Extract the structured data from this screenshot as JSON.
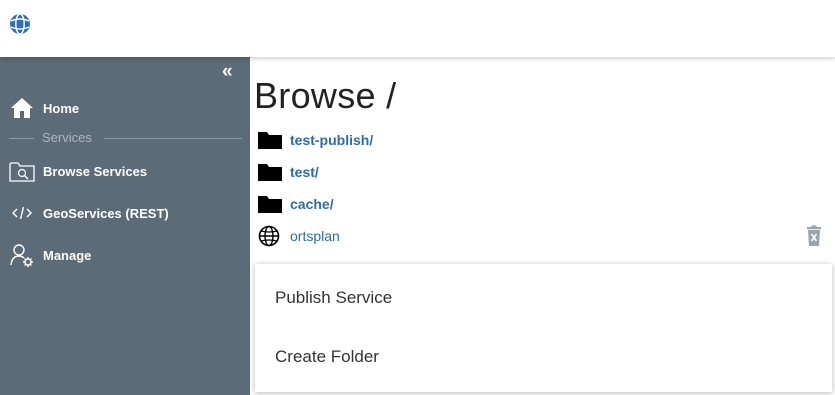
{
  "header": {
    "logo_icon": "globe-logo-icon"
  },
  "sidebar": {
    "collapse_glyph": "«",
    "items": [
      {
        "label": "Home",
        "icon": "home-icon"
      },
      {
        "label": "Browse Services",
        "icon": "browse-services-icon"
      },
      {
        "label": "GeoServices (REST)",
        "icon": "code-icon"
      },
      {
        "label": "Manage",
        "icon": "manage-user-gear-icon"
      }
    ],
    "section_label": "Services",
    "background": "#5b6b78"
  },
  "main": {
    "title": "Browse /",
    "entries": [
      {
        "label": "test-publish/",
        "type": "folder",
        "icon": "folder-icon"
      },
      {
        "label": "test/",
        "type": "folder",
        "icon": "folder-icon"
      },
      {
        "label": "cache/",
        "type": "folder",
        "icon": "folder-icon"
      },
      {
        "label": "ortsplan",
        "type": "service",
        "icon": "globe-icon"
      }
    ],
    "delete_icon": "trash-icon",
    "link_color": "#2e6da4"
  },
  "menu": {
    "items": [
      {
        "label": "Publish Service"
      },
      {
        "label": "Create Folder"
      }
    ]
  }
}
